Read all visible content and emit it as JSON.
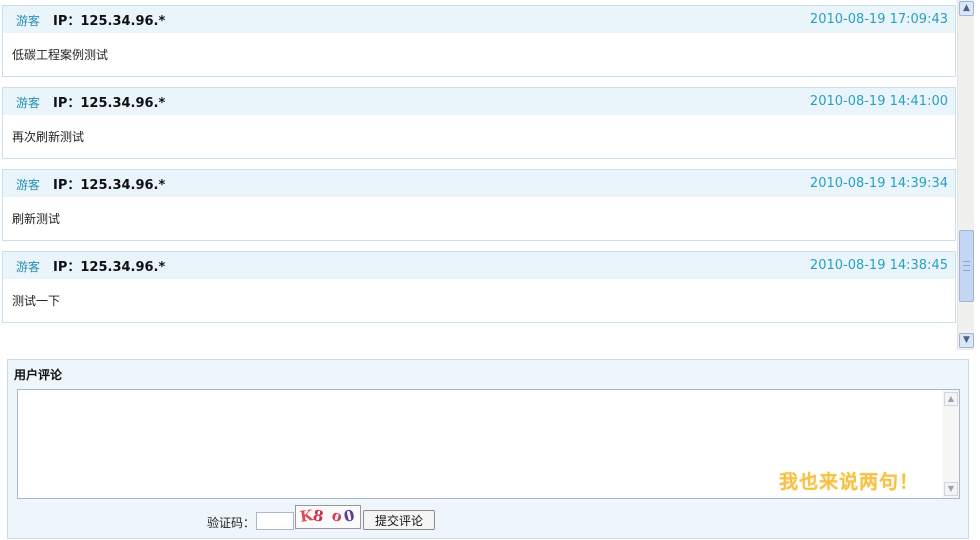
{
  "comments": [
    {
      "author": "游客",
      "ip": "IP：125.34.96.*",
      "time": "2010-08-19 17:09:43",
      "text": "低碳工程案例测试"
    },
    {
      "author": "游客",
      "ip": "IP：125.34.96.*",
      "time": "2010-08-19 14:41:00",
      "text": "再次刷新测试"
    },
    {
      "author": "游客",
      "ip": "IP：125.34.96.*",
      "time": "2010-08-19 14:39:34",
      "text": "刷新测试"
    },
    {
      "author": "游客",
      "ip": "IP：125.34.96.*",
      "time": "2010-08-19 14:38:45",
      "text": "测试一下"
    }
  ],
  "form": {
    "title": "用户评论",
    "textarea_value": "",
    "slogan": "我也来说两句！",
    "captcha_label": "验证码：",
    "captcha_value": "",
    "captcha_chars": [
      "K",
      "8",
      "o",
      "0"
    ],
    "submit_label": "提交评论"
  },
  "icons": {
    "scroll_up": "chevron-up-icon",
    "scroll_down": "chevron-down-icon"
  },
  "colors": {
    "header_bg": "#eaf5fb",
    "timestamp": "#2a9fc0",
    "slogan": "#f4c14a"
  }
}
